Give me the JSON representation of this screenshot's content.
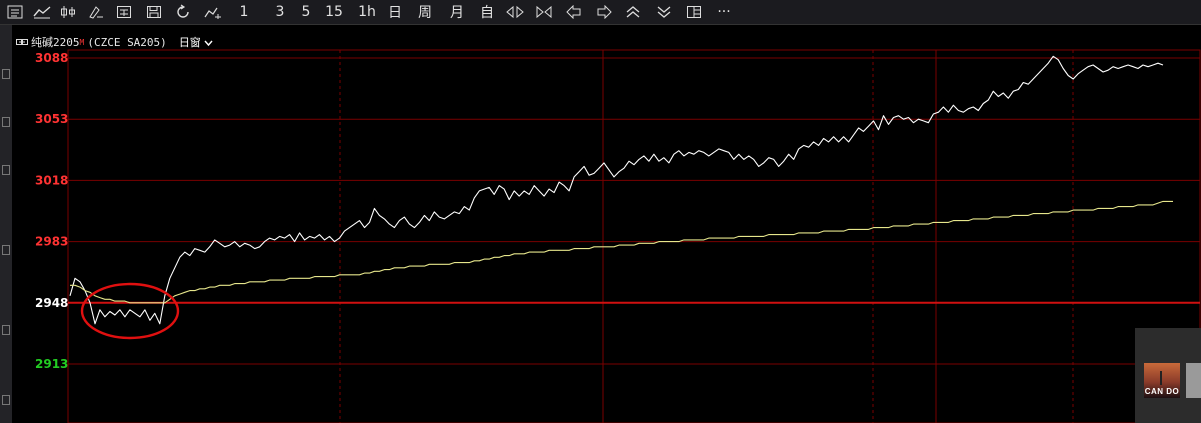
{
  "toolbar": {
    "items": [
      {
        "name": "menu-list-icon",
        "label": ""
      },
      {
        "name": "line-chart-icon",
        "label": ""
      },
      {
        "name": "candlestick-icon",
        "label": ""
      },
      {
        "name": "rename-icon",
        "label": ""
      },
      {
        "name": "calc-icon",
        "label": ""
      },
      {
        "name": "save-icon",
        "label": ""
      },
      {
        "name": "refresh-icon",
        "label": ""
      },
      {
        "name": "draw-tool-icon",
        "label": ""
      },
      {
        "name": "period-1min",
        "label": "1"
      },
      {
        "name": "period-3min",
        "label": "3"
      },
      {
        "name": "period-5min",
        "label": "5"
      },
      {
        "name": "period-15min",
        "label": "15"
      },
      {
        "name": "period-1h",
        "label": "1h"
      },
      {
        "name": "period-day",
        "label": "日"
      },
      {
        "name": "period-week",
        "label": "周"
      },
      {
        "name": "period-month",
        "label": "月"
      },
      {
        "name": "period-custom",
        "label": "自"
      },
      {
        "name": "zoom-in-icon",
        "label": ""
      },
      {
        "name": "zoom-out-icon",
        "label": ""
      },
      {
        "name": "arrow-left-icon",
        "label": ""
      },
      {
        "name": "arrow-right-icon",
        "label": ""
      },
      {
        "name": "double-up-icon",
        "label": ""
      },
      {
        "name": "double-down-icon",
        "label": ""
      },
      {
        "name": "layout-icon",
        "label": ""
      },
      {
        "name": "more-icon",
        "label": "···"
      }
    ]
  },
  "header": {
    "instrument": "纯碱2205",
    "marker": "M",
    "code": "(CZCE SA205)",
    "period_label": "日窗",
    "dropdown_icon": "chevron-down-icon"
  },
  "colors": {
    "price_line": "#ffffff",
    "avg_line": "#e6e68c",
    "grid": "#7a0000",
    "ref_line": "#d01010",
    "label_up": "#ff3333",
    "label_ref": "#ffffff",
    "label_down": "#22cc22",
    "annotation": "#e01010"
  },
  "chart_data": {
    "type": "line",
    "yticks": [
      {
        "value": 3088,
        "label": "3088",
        "color": "up"
      },
      {
        "value": 3053,
        "label": "3053",
        "color": "up"
      },
      {
        "value": 3018,
        "label": "3018",
        "color": "up"
      },
      {
        "value": 2983,
        "label": "2983",
        "color": "up"
      },
      {
        "value": 2948,
        "label": "2948",
        "color": "ref"
      },
      {
        "value": 2913,
        "label": "2913",
        "color": "down"
      }
    ],
    "ylim": [
      2880,
      3092
    ],
    "reference_value": 2948,
    "n_points": 220,
    "series": [
      {
        "key": "price",
        "values": [
          2952,
          2962,
          2960,
          2955,
          2948,
          2936,
          2944,
          2940,
          2943,
          2941,
          2944,
          2940,
          2944,
          2942,
          2940,
          2944,
          2938,
          2942,
          2936,
          2952,
          2962,
          2968,
          2974,
          2977,
          2975,
          2979,
          2978,
          2977,
          2980,
          2984,
          2982,
          2980,
          2981,
          2983,
          2980,
          2982,
          2981,
          2979,
          2980,
          2983,
          2985,
          2984,
          2986,
          2985,
          2987,
          2983,
          2988,
          2984,
          2986,
          2985,
          2987,
          2984,
          2986,
          2983,
          2985,
          2989,
          2991,
          2993,
          2995,
          2991,
          2994,
          3002,
          2998,
          2996,
          2993,
          2991,
          2995,
          2997,
          2993,
          2991,
          2994,
          2998,
          2995,
          3000,
          2997,
          2996,
          2998,
          3000,
          2999,
          3003,
          3001,
          3008,
          3012,
          3013,
          3014,
          3010,
          3015,
          3013,
          3007,
          3012,
          3009,
          3012,
          3010,
          3015,
          3012,
          3009,
          3013,
          3011,
          3017,
          3015,
          3012,
          3020,
          3023,
          3026,
          3021,
          3022,
          3025,
          3028,
          3024,
          3020,
          3023,
          3025,
          3029,
          3027,
          3030,
          3032,
          3029,
          3033,
          3029,
          3031,
          3028,
          3033,
          3035,
          3032,
          3034,
          3033,
          3035,
          3034,
          3032,
          3034,
          3036,
          3035,
          3034,
          3030,
          3033,
          3030,
          3032,
          3030,
          3026,
          3028,
          3031,
          3030,
          3026,
          3029,
          3033,
          3030,
          3036,
          3038,
          3037,
          3040,
          3038,
          3042,
          3040,
          3043,
          3040,
          3043,
          3040,
          3044,
          3048,
          3046,
          3049,
          3052,
          3047,
          3055,
          3050,
          3054,
          3055,
          3053,
          3054,
          3051,
          3053,
          3052,
          3051,
          3056,
          3057,
          3060,
          3057,
          3061,
          3058,
          3057,
          3059,
          3060,
          3058,
          3062,
          3064,
          3069,
          3066,
          3068,
          3065,
          3069,
          3070,
          3074,
          3073,
          3076,
          3079,
          3082,
          3085,
          3089,
          3087,
          3082,
          3078,
          3076,
          3079,
          3081,
          3083,
          3084,
          3082,
          3080,
          3081,
          3083,
          3082,
          3083,
          3084,
          3083,
          3082,
          3084,
          3083,
          3084,
          3085,
          3084
        ]
      },
      {
        "key": "average",
        "values": [
          2958,
          2958,
          2957,
          2955,
          2954,
          2952,
          2951,
          2950,
          2950,
          2949,
          2949,
          2949,
          2948,
          2948,
          2948,
          2948,
          2948,
          2948,
          2948,
          2948,
          2950,
          2952,
          2953,
          2954,
          2955,
          2955,
          2956,
          2956,
          2957,
          2957,
          2958,
          2958,
          2958,
          2959,
          2959,
          2959,
          2960,
          2960,
          2960,
          2960,
          2961,
          2961,
          2961,
          2961,
          2962,
          2962,
          2962,
          2962,
          2962,
          2963,
          2963,
          2963,
          2963,
          2963,
          2964,
          2964,
          2964,
          2964,
          2964,
          2965,
          2965,
          2966,
          2966,
          2967,
          2967,
          2968,
          2968,
          2968,
          2969,
          2969,
          2969,
          2969,
          2970,
          2970,
          2970,
          2970,
          2970,
          2971,
          2971,
          2971,
          2971,
          2972,
          2972,
          2973,
          2973,
          2974,
          2974,
          2975,
          2975,
          2976,
          2976,
          2976,
          2977,
          2977,
          2977,
          2977,
          2978,
          2978,
          2978,
          2978,
          2978,
          2979,
          2979,
          2979,
          2979,
          2980,
          2980,
          2980,
          2980,
          2980,
          2981,
          2981,
          2981,
          2981,
          2982,
          2982,
          2982,
          2982,
          2983,
          2983,
          2983,
          2983,
          2983,
          2984,
          2984,
          2984,
          2984,
          2984,
          2985,
          2985,
          2985,
          2985,
          2985,
          2985,
          2986,
          2986,
          2986,
          2986,
          2986,
          2986,
          2987,
          2987,
          2987,
          2987,
          2987,
          2987,
          2988,
          2988,
          2988,
          2988,
          2988,
          2989,
          2989,
          2989,
          2989,
          2989,
          2990,
          2990,
          2990,
          2990,
          2990,
          2991,
          2991,
          2991,
          2991,
          2992,
          2992,
          2992,
          2992,
          2993,
          2993,
          2993,
          2993,
          2994,
          2994,
          2994,
          2994,
          2995,
          2995,
          2995,
          2995,
          2996,
          2996,
          2996,
          2996,
          2997,
          2997,
          2997,
          2997,
          2998,
          2998,
          2998,
          2998,
          2999,
          2999,
          2999,
          2999,
          3000,
          3000,
          3000,
          3000,
          3001,
          3001,
          3001,
          3001,
          3001,
          3002,
          3002,
          3002,
          3002,
          3003,
          3003,
          3003,
          3003,
          3004,
          3004,
          3004,
          3004,
          3005,
          3006,
          3006,
          3006
        ]
      }
    ],
    "annotation": {
      "type": "ellipse",
      "label": ""
    }
  }
}
